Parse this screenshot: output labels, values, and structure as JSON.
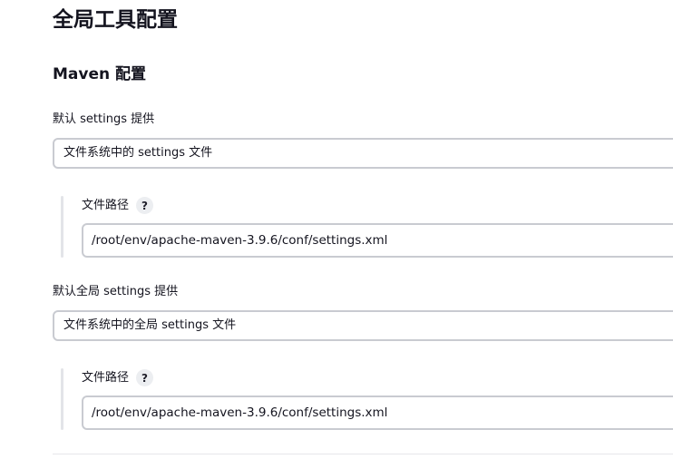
{
  "page": {
    "title": "全局工具配置"
  },
  "maven": {
    "section_title": "Maven 配置",
    "default_settings": {
      "label": "默认 settings 提供",
      "selected": "文件系统中的 settings 文件",
      "path_label": "文件路径",
      "help": "?",
      "path_value": "/root/env/apache-maven-3.9.6/conf/settings.xml"
    },
    "global_settings": {
      "label": "默认全局 settings 提供",
      "selected": "文件系统中的全局 settings 文件",
      "path_label": "文件路径",
      "help": "?",
      "path_value": "/root/env/apache-maven-3.9.6/conf/settings.xml"
    }
  }
}
